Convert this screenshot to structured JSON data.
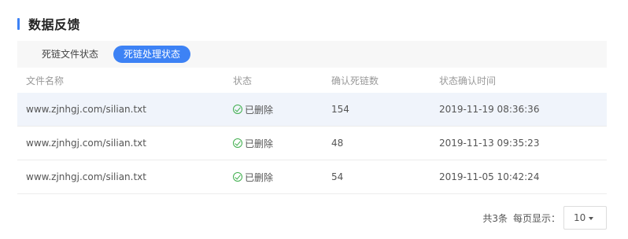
{
  "section": {
    "title": "数据反馈"
  },
  "tabs": [
    {
      "label": "死链文件状态",
      "active": false
    },
    {
      "label": "死链处理状态",
      "active": true
    }
  ],
  "table": {
    "columns": [
      "文件名称",
      "状态",
      "确认死链数",
      "状态确认时间"
    ],
    "rows": [
      {
        "file": "www.zjnhgj.com/silian.txt",
        "status": "已删除",
        "count": "154",
        "time": "2019-11-19 08:36:36"
      },
      {
        "file": "www.zjnhgj.com/silian.txt",
        "status": "已删除",
        "count": "48",
        "time": "2019-11-13 09:35:23"
      },
      {
        "file": "www.zjnhgj.com/silian.txt",
        "status": "已删除",
        "count": "54",
        "time": "2019-11-05 10:42:24"
      }
    ]
  },
  "pager": {
    "total": "共3条",
    "per_page_label": "每页显示：",
    "per_page_value": "10"
  },
  "colors": {
    "accent": "#3d82f5",
    "success": "#3fae4d",
    "row_highlight": "#f0f4fb"
  },
  "icons": {
    "status": "check-circle-icon",
    "select": "caret-down-icon"
  }
}
